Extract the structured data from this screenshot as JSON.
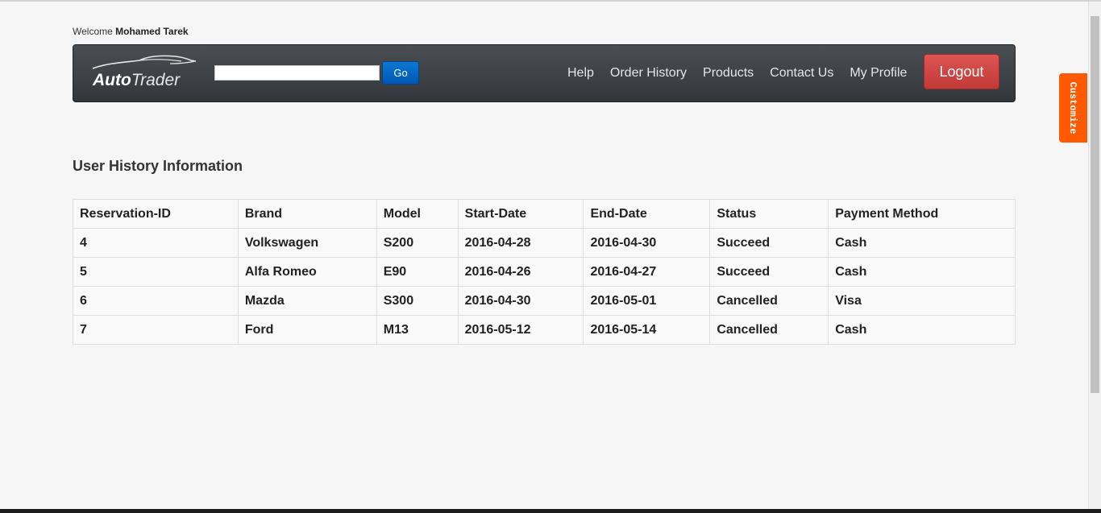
{
  "header": {
    "welcome_prefix": "Welcome",
    "user_name": "Mohamed Tarek"
  },
  "logo": {
    "auto": "Auto",
    "trader": "Trader"
  },
  "search": {
    "value": "",
    "placeholder": "",
    "go_label": "Go"
  },
  "nav": {
    "links": [
      "Help",
      "Order History",
      "Products",
      "Contact Us",
      "My Profile"
    ],
    "logout_label": "Logout"
  },
  "customize_tab": {
    "label": "Customize"
  },
  "main": {
    "title": "User History Information",
    "table": {
      "columns": [
        "Reservation-ID",
        "Brand",
        "Model",
        "Start-Date",
        "End-Date",
        "Status",
        "Payment Method"
      ],
      "rows": [
        [
          "4",
          "Volkswagen",
          "S200",
          "2016-04-28",
          "2016-04-30",
          "Succeed",
          "Cash"
        ],
        [
          "5",
          "Alfa Romeo",
          "E90",
          "2016-04-26",
          "2016-04-27",
          "Succeed",
          "Cash"
        ],
        [
          "6",
          "Mazda",
          "S300",
          "2016-04-30",
          "2016-05-01",
          "Cancelled",
          "Visa"
        ],
        [
          "7",
          "Ford",
          "M13",
          "2016-05-12",
          "2016-05-14",
          "Cancelled",
          "Cash"
        ]
      ]
    }
  },
  "colors": {
    "navbar": "#3a3e43",
    "go_button": "#0a6fc8",
    "logout_button": "#d04a47",
    "customize_tab": "#ff5a00"
  }
}
